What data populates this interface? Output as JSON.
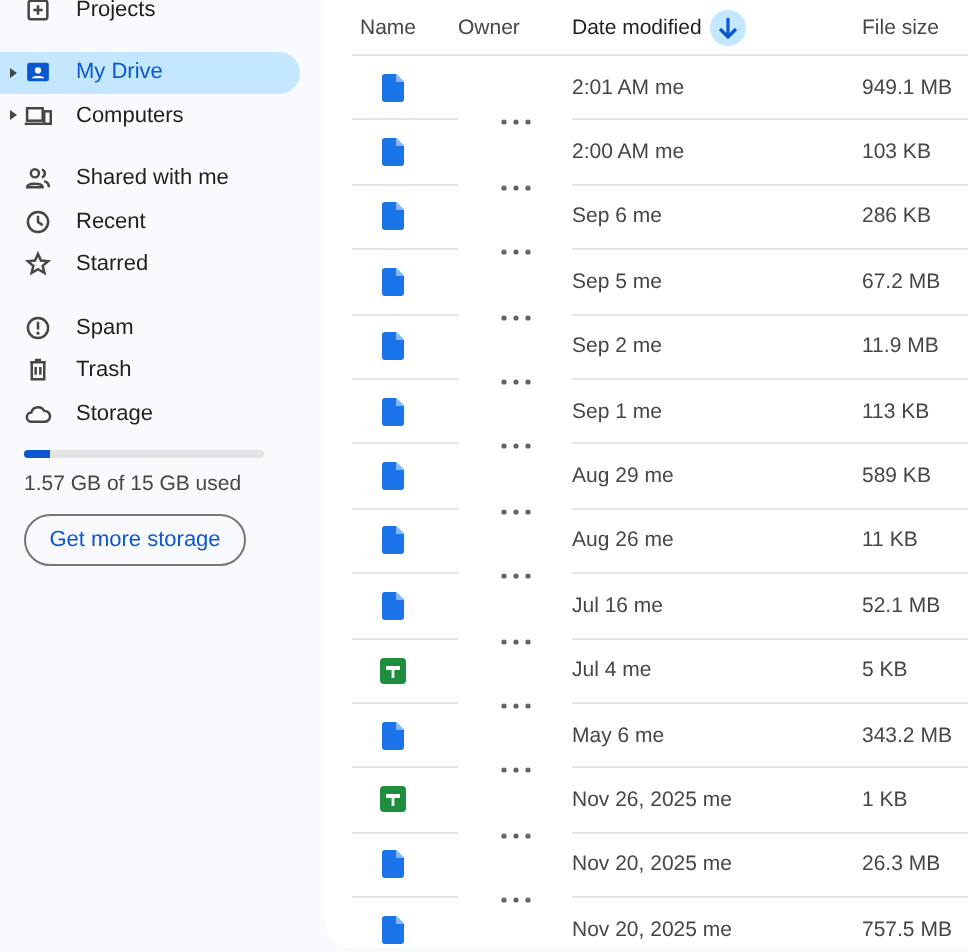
{
  "sidebar": {
    "items": [
      {
        "label": "Projects",
        "selected": false
      },
      {
        "label": "My Drive",
        "selected": true,
        "expanded": false
      },
      {
        "label": "Computers",
        "selected": false,
        "expanded": false
      },
      {
        "label": "Shared with me",
        "selected": false
      },
      {
        "label": "Recent",
        "selected": false
      },
      {
        "label": "Starred",
        "selected": false
      },
      {
        "label": "Spam",
        "selected": false
      },
      {
        "label": "Trash",
        "selected": false
      },
      {
        "label": "Storage",
        "selected": false
      }
    ],
    "storage": {
      "level": 0.105,
      "text": "1.57 GB of 15 GB used",
      "button": "Get more storage"
    }
  },
  "table": {
    "columns": [
      {
        "label": "Name",
        "sorted": false
      },
      {
        "label": "Owner",
        "sorted": false
      },
      {
        "label": "Date modified",
        "sorted": true
      },
      {
        "label": "File size",
        "sorted": false
      }
    ],
    "rows": [
      {
        "kind": "doc",
        "modified": "2:01 AM me",
        "size": "949.1 MB"
      },
      {
        "kind": "doc",
        "modified": "2:00 AM me",
        "size": "103 KB"
      },
      {
        "kind": "doc",
        "modified": "Sep 6 me",
        "size": "286 KB"
      },
      {
        "kind": "doc",
        "modified": "Sep 5 me",
        "size": "67.2 MB"
      },
      {
        "kind": "doc",
        "modified": "Sep 2 me",
        "size": "11.9 MB"
      },
      {
        "kind": "doc",
        "modified": "Sep 1 me",
        "size": "113 KB"
      },
      {
        "kind": "doc",
        "modified": "Aug 29 me",
        "size": "589 KB"
      },
      {
        "kind": "doc",
        "modified": "Aug 26 me",
        "size": "11 KB"
      },
      {
        "kind": "doc",
        "modified": "Jul 16 me",
        "size": "52.1 MB"
      },
      {
        "kind": "sheet",
        "modified": "Jul 4 me",
        "size": "5 KB"
      },
      {
        "kind": "doc",
        "modified": "May 6 me",
        "size": "343.2 MB"
      },
      {
        "kind": "sheet",
        "modified": "Nov 26, 2025 me",
        "size": "1 KB"
      },
      {
        "kind": "doc",
        "modified": "Nov 20, 2025 me",
        "size": "26.3 MB"
      },
      {
        "kind": "doc",
        "modified": "Nov 20, 2025 me",
        "size": "757.5 MB"
      }
    ]
  }
}
